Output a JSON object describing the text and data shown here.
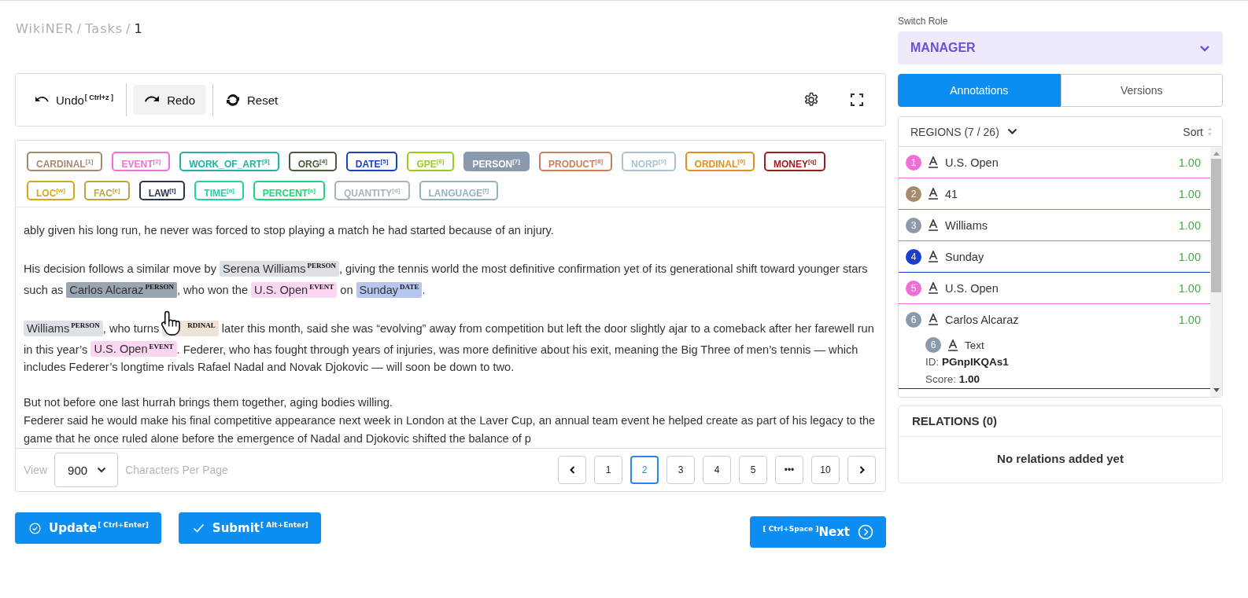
{
  "breadcrumb": {
    "items": [
      "WikiNER",
      "Tasks"
    ],
    "current": "1",
    "separators": [
      "/",
      "/"
    ]
  },
  "toolbar": {
    "undo": {
      "label": "Undo",
      "shortcut": "[ Ctrl+z ]"
    },
    "redo": {
      "label": "Redo"
    },
    "reset": {
      "label": "Reset"
    }
  },
  "labels": [
    {
      "name": "CARDINAL",
      "key": "[1]",
      "color": "#a58a6e",
      "selected": false
    },
    {
      "name": "EVENT",
      "key": "[2]",
      "color": "#f06fd6",
      "selected": false
    },
    {
      "name": "WORK_OF_ART",
      "key": "[3]",
      "color": "#1fb3a6",
      "selected": false
    },
    {
      "name": "ORG",
      "key": "[4]",
      "color": "#4a5a3a",
      "selected": false
    },
    {
      "name": "DATE",
      "key": "[5]",
      "color": "#1a3fcf",
      "selected": false
    },
    {
      "name": "GPE",
      "key": "[6]",
      "color": "#9acd1a",
      "selected": false
    },
    {
      "name": "PERSON",
      "key": "[7]",
      "color": "#8a99ab",
      "selected": true
    },
    {
      "name": "PRODUCT",
      "key": "[8]",
      "color": "#c8805a",
      "selected": false
    },
    {
      "name": "NORP",
      "key": "[9]",
      "color": "#a8c4d2",
      "selected": false
    },
    {
      "name": "ORDINAL",
      "key": "[0]",
      "color": "#e0901a",
      "selected": false
    },
    {
      "name": "MONEY",
      "key": "[q]",
      "color": "#a01c1c",
      "selected": false
    },
    {
      "name": "LOC",
      "key": "[w]",
      "color": "#d8a81a",
      "selected": false
    },
    {
      "name": "FAC",
      "key": "[e]",
      "color": "#c0a040",
      "selected": false
    },
    {
      "name": "LAW",
      "key": "[t]",
      "color": "#2a3550",
      "selected": false
    },
    {
      "name": "TIME",
      "key": "[a]",
      "color": "#1ed3a6",
      "selected": false
    },
    {
      "name": "PERCENT",
      "key": "[s]",
      "color": "#1ad87a",
      "selected": false
    },
    {
      "name": "QUANTITY",
      "key": "[d]",
      "color": "#a8b4bc",
      "selected": false
    },
    {
      "name": "LANGUAGE",
      "key": "[f]",
      "color": "#93b4bd",
      "selected": false
    }
  ],
  "paragraphs": [
    {
      "blocks": [
        [
          {
            "text": "ably given his long run, he never was forced to stop playing a match he had started because of an injury."
          }
        ]
      ]
    },
    {
      "blocks": [
        [
          {
            "text": "His decision follows a similar move by "
          },
          {
            "text": "Serena Williams",
            "label": "PERSON",
            "color": "#dde1e6",
            "selected": false
          },
          {
            "text": ", giving the tennis world the most definitive confirmation yet of its generational shift toward younger stars such as "
          },
          {
            "text": "Carlos Alcaraz",
            "label": "PERSON",
            "color": "#9aa5b1",
            "selected": true
          },
          {
            "text": ", who won the "
          },
          {
            "text": "U.S. Open",
            "label": "EVENT",
            "color": "#fbd6f3",
            "selected": false
          },
          {
            "text": " on "
          },
          {
            "text": "Sunday",
            "label": "DATE",
            "color": "#b7c6ef",
            "selected": false
          },
          {
            "text": "."
          }
        ]
      ]
    },
    {
      "blocks": [
        [
          {
            "text": "Williams",
            "label": "PERSON",
            "color": "#dde1e6",
            "selected": false
          },
          {
            "text": ", who turns "
          },
          {
            "label": "RDINAL",
            "color": "#ede3d8",
            "selected": false,
            "covered": true
          },
          {
            "text": " later this month, said she was “evolving” away from competition but left the door slightly ajar to a comeback after her farewell run in this year’s "
          },
          {
            "text": "U.S. Open",
            "label": "EVENT",
            "color": "#fbd6f3",
            "selected": false
          },
          {
            "text": ". Federer, who has fought through years of injuries, was more definitive about his exit, meaning the Big Three of men’s tennis — which includes Federer’s longtime rivals Rafael Nadal and Novak Djokovic — will soon be down to two."
          }
        ]
      ]
    },
    {
      "blocks": [
        [
          {
            "text": "But not before one last hurrah brings them together, aging bodies willing."
          }
        ],
        [
          {
            "text": "Federer said he would make his final competitive appearance next week in London at the Laver Cup, an annual team event he helped create as part of his legacy to the game that he once ruled alone before the emergence of Nadal and Djokovic shifted the balance of p"
          }
        ]
      ]
    }
  ],
  "footer": {
    "view_label": "View",
    "page_size": "900",
    "per_page_label": "Characters Per Page",
    "pages": [
      {
        "label": "1",
        "selected": false
      },
      {
        "label": "2",
        "selected": true
      },
      {
        "label": "3",
        "selected": false
      },
      {
        "label": "4",
        "selected": false
      },
      {
        "label": "5",
        "selected": false
      },
      {
        "label": "•••",
        "selected": false
      },
      {
        "label": "10",
        "selected": false
      }
    ]
  },
  "actions": [
    {
      "kind": "update",
      "label": "Update",
      "shortcut": "[ Ctrl+Enter]"
    },
    {
      "kind": "submit",
      "label": "Submit",
      "shortcut": "[ Alt+Enter]"
    },
    {
      "kind": "next",
      "label": "Next",
      "shortcut": "[ Ctrl+Space ]"
    }
  ],
  "sidebar": {
    "role_label": "Switch Role",
    "role": "MANAGER",
    "tabs": [
      {
        "label": "Annotations",
        "selected": true
      },
      {
        "label": "Versions",
        "selected": false
      }
    ],
    "regions_title": "REGIONS (7 / 26)",
    "sort_label": "Sort",
    "regions": [
      {
        "number": "1",
        "text": "U.S. Open",
        "score": "1.00",
        "color": "#f06fd6",
        "expanded": false
      },
      {
        "number": "2",
        "text": "41",
        "score": "1.00",
        "color": "#a58a6e",
        "expanded": false
      },
      {
        "number": "3",
        "text": "Williams",
        "score": "1.00",
        "color": "#8a99ab",
        "expanded": false
      },
      {
        "number": "4",
        "text": "Sunday",
        "score": "1.00",
        "color": "#1a3fcf",
        "expanded": false
      },
      {
        "number": "5",
        "text": "U.S. Open",
        "score": "1.00",
        "color": "#f06fd6",
        "expanded": false
      },
      {
        "number": "6",
        "text": "Carlos Alcaraz",
        "score": "1.00",
        "color": "#8a99ab",
        "expanded": true,
        "detail": {
          "number": "6",
          "text": "Text",
          "id_label": "ID:",
          "id": "PGnpIKQAs1",
          "score_label": "Score:",
          "score": "1.00"
        }
      }
    ],
    "relations_title": "RELATIONS (0)",
    "relations_empty": "No relations added yet"
  }
}
